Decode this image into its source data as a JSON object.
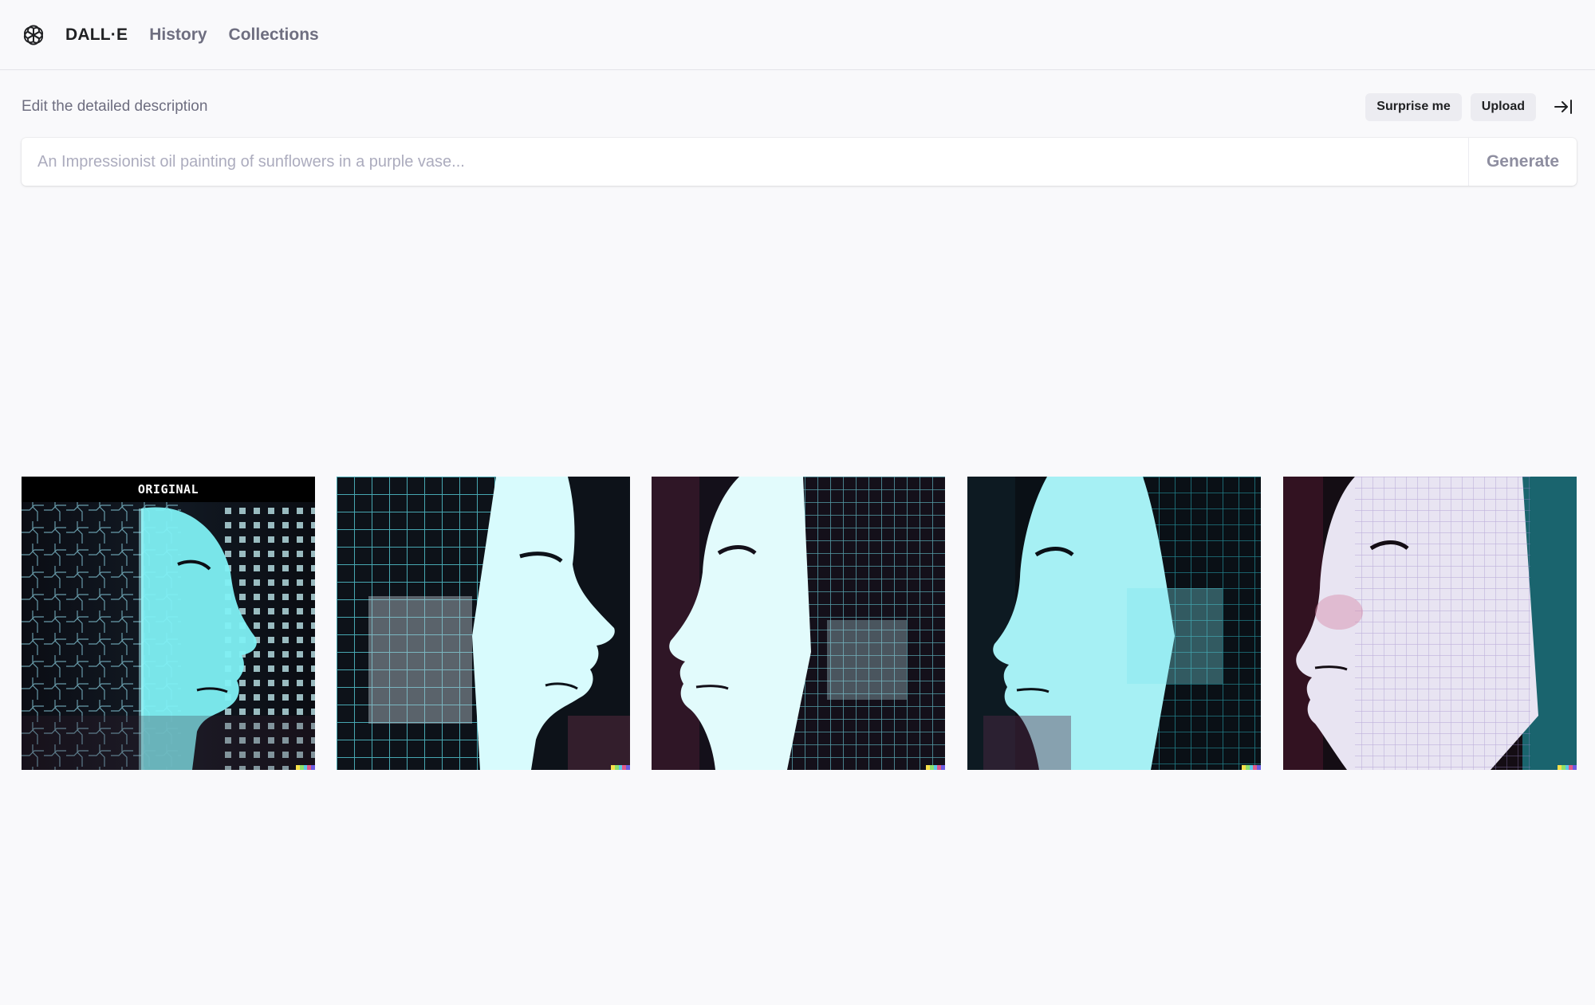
{
  "header": {
    "brand": "DALL·E",
    "nav": [
      {
        "label": "History"
      },
      {
        "label": "Collections"
      }
    ]
  },
  "editor": {
    "description_label": "Edit the detailed description",
    "surprise_label": "Surprise me",
    "upload_label": "Upload",
    "prompt_placeholder": "An Impressionist oil painting of sunflowers in a purple vase...",
    "prompt_value": "",
    "generate_label": "Generate"
  },
  "gallery": {
    "original_badge": "ORIGINAL",
    "images": [
      {
        "kind": "original",
        "subject": "face-profile-right-circuit"
      },
      {
        "kind": "variation",
        "subject": "face-profile-right-glitch"
      },
      {
        "kind": "variation",
        "subject": "face-profile-left-glitch"
      },
      {
        "kind": "variation",
        "subject": "face-profile-left-glitch"
      },
      {
        "kind": "variation",
        "subject": "face-profile-left-pastel"
      }
    ]
  },
  "colors": {
    "accent_cyan": "#5ce8ee",
    "signature": [
      "#f7e04a",
      "#8ee06a",
      "#5bc8e8",
      "#e05a8a",
      "#6a5ce0"
    ]
  }
}
